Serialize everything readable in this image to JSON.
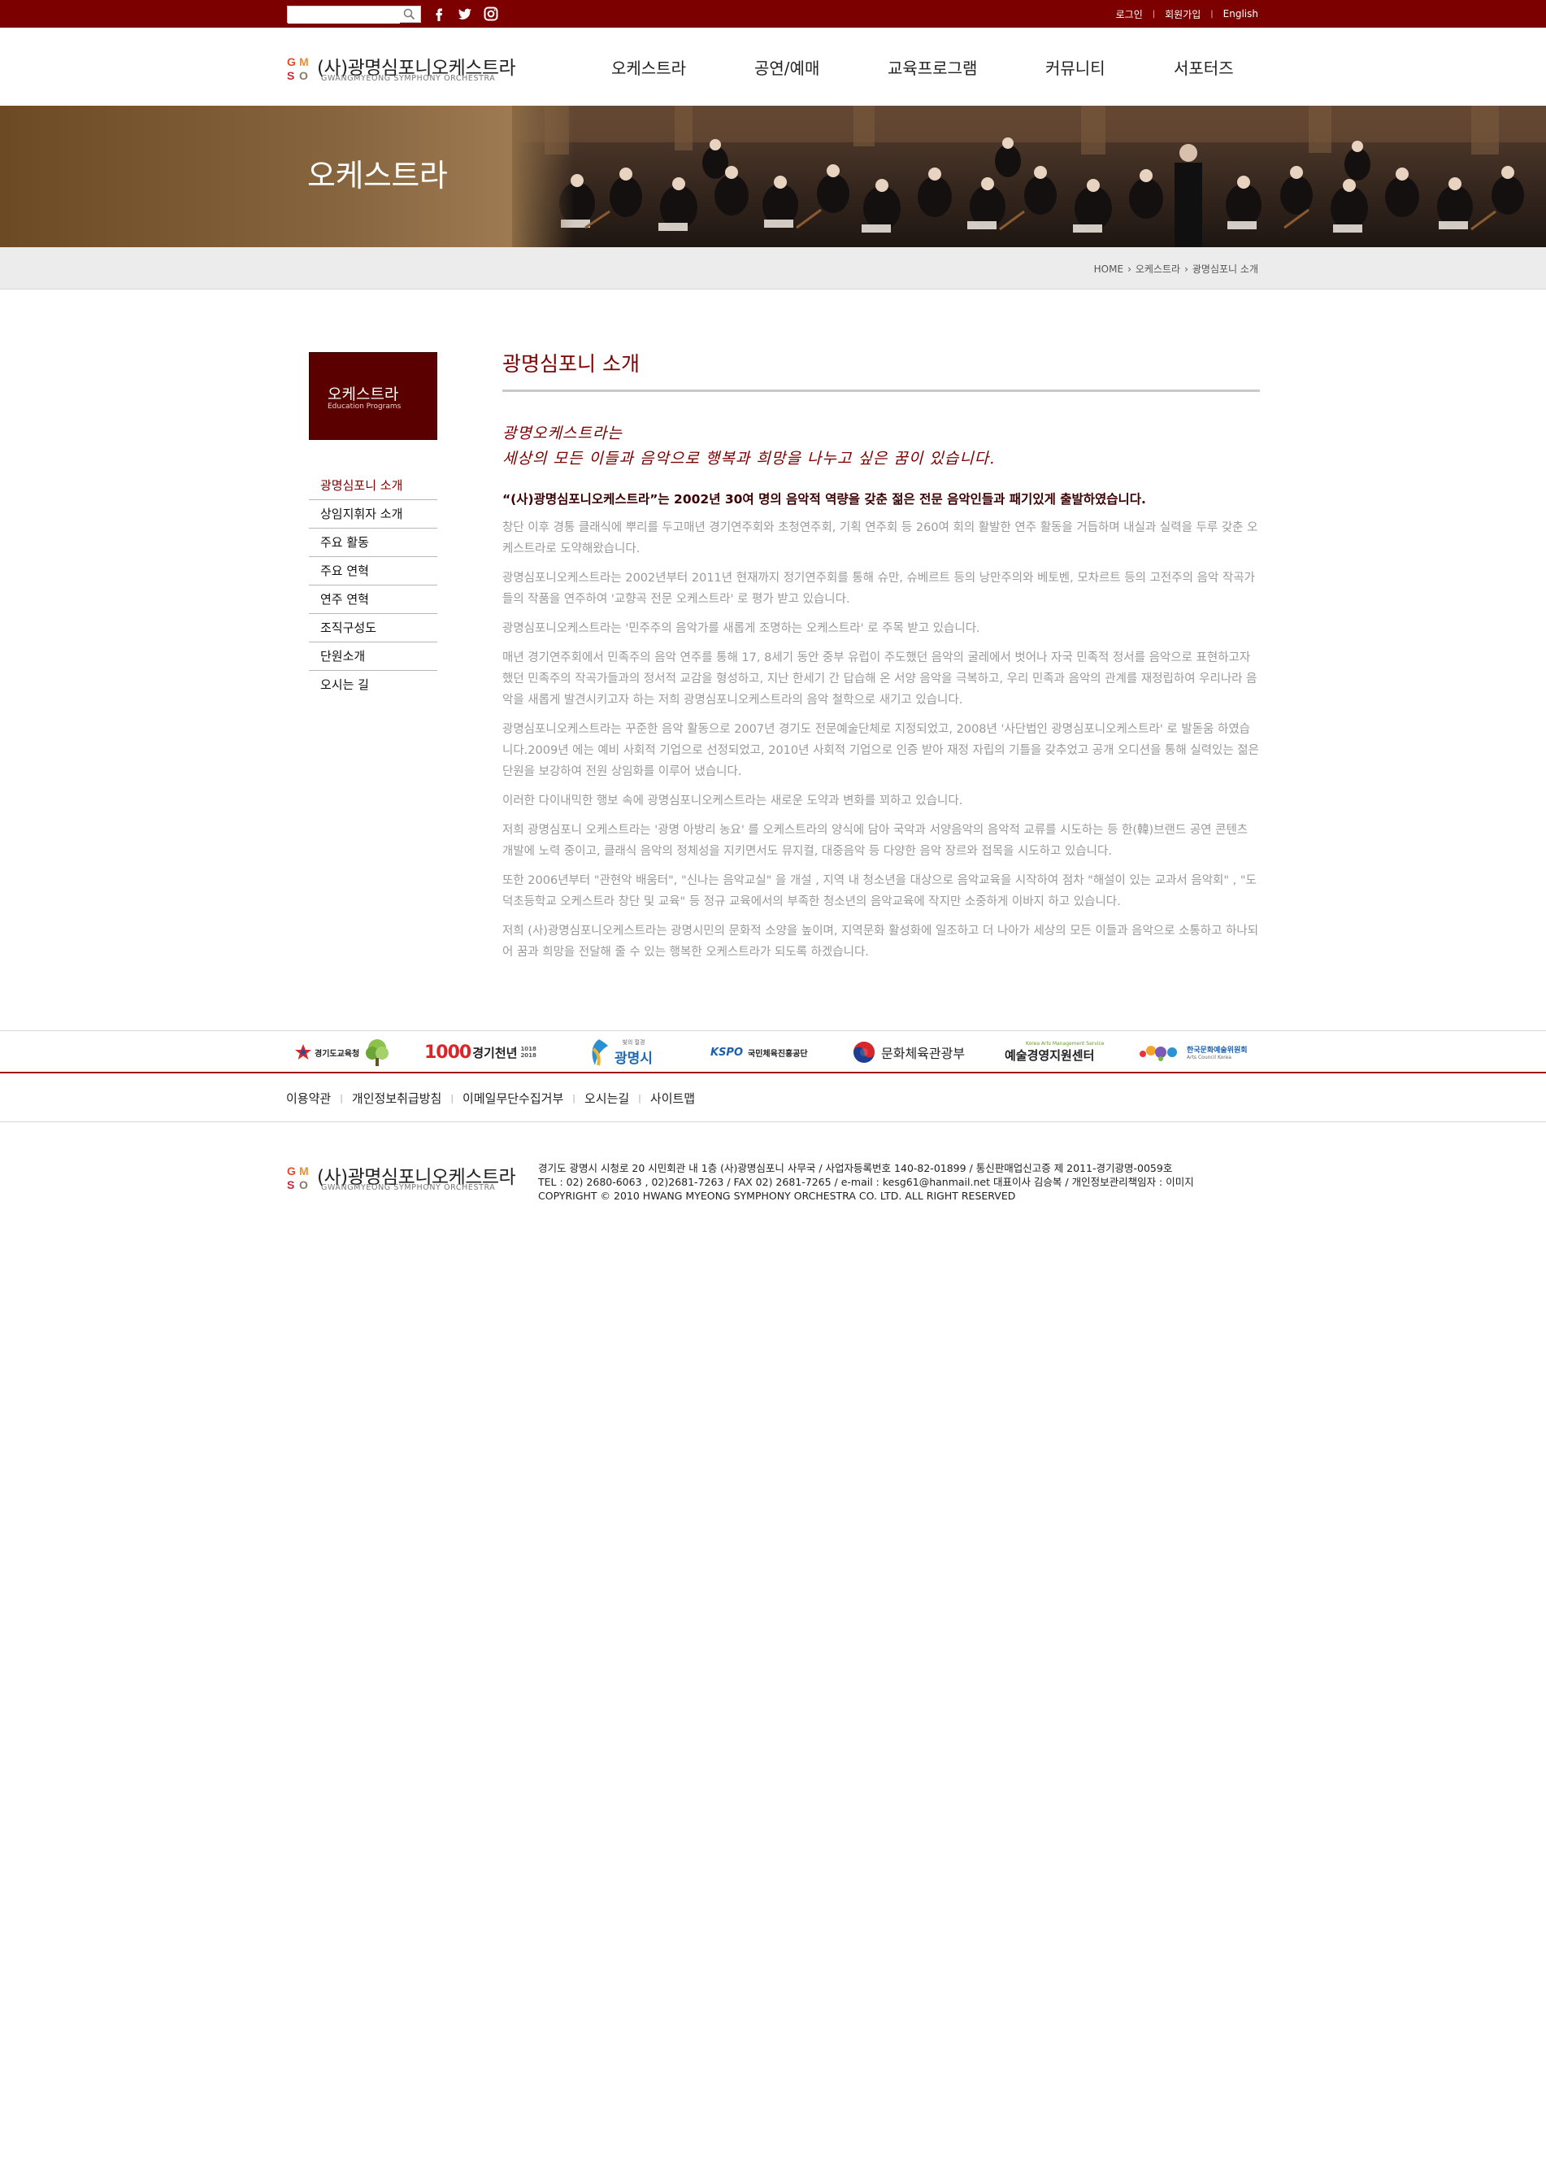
{
  "topbar": {
    "search": {
      "placeholder": ""
    },
    "links": {
      "login": "로그인",
      "join": "회원가입",
      "english": "English"
    }
  },
  "header": {
    "logo": {
      "mark": "GMSO",
      "kr": "(사)광명심포니오케스트라",
      "en": "GWANGMYEONG SYMPHONY ORCHESTRA"
    },
    "gnb": [
      "오케스트라",
      "공연/예매",
      "교육프로그램",
      "커뮤니티",
      "서포터즈"
    ]
  },
  "banner": {
    "title": "오케스트라"
  },
  "breadcrumb": {
    "home": "HOME",
    "level1": "오케스트라",
    "current": "광명심포니 소개"
  },
  "lnb": {
    "head_kr": "오케스트라",
    "head_en": "Education Programs",
    "items": [
      "광명심포니 소개",
      "상임지휘자 소개",
      "주요 활동",
      "주요 연혁",
      "연주 연혁",
      "조직구성도",
      "단원소개",
      "오시는 길"
    ]
  },
  "content": {
    "title": "광명심포니 소개",
    "slogan_line1": "광명오케스트라는",
    "slogan_line2": "세상의 모든 이들과 음악으로 행복과 희망을 나누고 싶은 꿈이 있습니다.",
    "lead": "“(사)광명심포니오케스트라”는 2002년 30여 명의 음악적 역량을 갖춘 젊은 전문 음악인들과 패기있게 출발하였습니다.",
    "paragraphs": [
      "창단 이후 경통 클래식에 뿌리를 두고매년  경기연주회와 초청연주회, 기획 연주회 등 260여 회의 활발한 연주 활동을 거듭하며 내실과 실력을 두루 갖춘 오케스트라로 도약해왔습니다.",
      "광명심포니오케스트라는 2002년부터 2011년 현재까지 정기연주회를 통해 슈만, 슈베르트 등의 낭만주의와 베토벤, 모차르트 등의 고전주의 음악 작곡가들의 작품을 연주하여 '교향곡 전문 오케스트라' 로 평가 받고 있습니다.",
      "광명심포니오케스트라는 '민주주의 음악가를 새롭게 조명하는 오케스트라' 로 주목 받고 있습니다.",
      "매년 경기연주회에서 민족주의 음악 연주를 통해 17, 8세기 동안 중부 유럽이 주도했던 음악의 굴레에서 벗어나 자국 민족적 정서를 음악으로 표현하고자 했던 민족주의 작곡가들과의 정서적 교감을 형성하고, 지난 한세기 간 답습해 온 서양 음악을 극복하고, 우리 민족과 음악의 관계를 재정립하여 우리나라 음악을 새롭게 발견시키고자 하는 저희 광명심포니오케스트라의 음악 철학으로 새기고 있습니다.",
      "광명심포니오케스트라는 꾸준한 음악 활동으로 2007년 경기도 전문예술단체로 지정되었고, 2008년 '사단법인 광명심포니오케스트라' 로 발돋움 하였습니다.2009년 에는 예비 사회적 기업으로 선정되었고, 2010년 사회적 기업으로 인증 받아 재정 자립의 기틀을 갖추었고 공개 오디션을 통해 실력있는 젊은 단원을 보강하여 전원 상임화를 이루어 냈습니다.",
      "이러한 다이내믹한 행보 속에 광명심포니오케스트라는 새로운 도약과 변화를 꾀하고 있습니다.",
      "저희 광명심포니 오케스트라는 '광명 아방리 농요' 를 오케스트라의 양식에 담아 국악과 서양음악의 음악적 교류를 시도하는 등 한(韓)브랜드 공연 콘텐츠 개발에 노력 중이고, 클래식 음악의 정체성을 지키면서도 뮤지컬, 대중음악 등 다양한 음악 장르와 접목을 시도하고 있습니다.",
      "또한 2006년부터 \"관현악 배움터\", \"신나는 음악교실\" 을 개설 , 지역 내 청소년을 대상으로 음악교육을 시작하여 점차 \"해설이 있는 교과서 음악회\" , \"도덕초등학교 오케스트라 창단 및 교육\" 등 정규 교육에서의 부족한 청소년의 음악교육에 작지만 소중하게 이바지 하고 있습니다.",
      "저희 (사)광명심포니오케스트라는 광명시민의 문화적 소양을 높이며, 지역문화 활성화에 일조하고 더 나아가 세상의 모든 이들과 음악으로 소통하고 하나되어 꿈과 희망을 전달해 줄 수 있는 행복한 오케스트라가 되도록 하겠습니다."
    ]
  },
  "sponsors": {
    "gyeonggi_edu": "경기도교육청",
    "gyeonggi_1000_num": "1000",
    "gyeonggi_1000_text": "경기천년",
    "gyeonggi_1000_years": "1018 2018",
    "gm_sub": "빛의 절경",
    "gm_city": "광명시",
    "kspo_logo": "KSPO",
    "kspo_name": "국민체육진흥공단",
    "culture": "문화체육관광부",
    "arts_mgmt_kr": "예술경영지원센터",
    "arts_mgmt_en": "Korea Arts Management Service",
    "arts_council_kr": "한국문화예술위원회",
    "arts_council_en": "Arts Council Korea"
  },
  "footer": {
    "links": [
      "이용약관",
      "개인정보취급방침",
      "이메일무단수집거부",
      "오시는길",
      "사이트맵"
    ],
    "address": "경기도 광명시 시청로 20 시민회관 내 1층 (사)광명심포니 사무국 / 사업자등록번호 140-82-01899 / 통신판매업신고증 제 2011-경기광명-0059호",
    "contact": "TEL : 02) 2680-6063 , 02)2681-7263 / FAX 02) 2681-7265 / e-mail : kesg61@hanmail.net 대표이사 김승복 / 개인정보관리책임자 : 이미지",
    "copyright": "COPYRIGHT © 2010 HWANG MYEONG SYMPHONY ORCHESTRA CO. LTD.  ALL RIGHT RESERVED"
  },
  "colors": {
    "brand": "#7d0000",
    "lnb_head": "#5a0000",
    "body_text": "#9a9a9a"
  },
  "icons": [
    "search-icon",
    "facebook-icon",
    "twitter-icon",
    "instagram-icon"
  ]
}
